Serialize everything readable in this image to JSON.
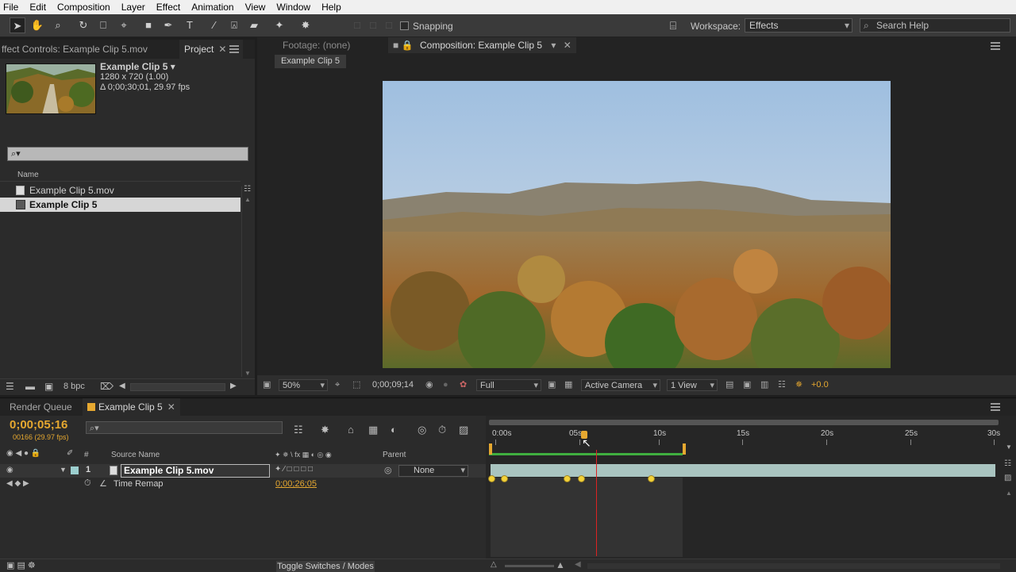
{
  "menu": [
    "File",
    "Edit",
    "Composition",
    "Layer",
    "Effect",
    "Animation",
    "View",
    "Window",
    "Help"
  ],
  "toolbar": {
    "snapping_label": "Snapping",
    "workspace_label": "Workspace:",
    "workspace_value": "Effects",
    "search_placeholder": "Search Help"
  },
  "left_panel": {
    "tabs": [
      "ffect Controls: Example Clip 5.mov",
      "Project"
    ],
    "project": {
      "name": "Example Clip 5 ▾",
      "info_line1": "1280 x 720 (1.00)",
      "info_line2": "Δ 0;00;30;01, 29.97 fps",
      "search_icon": "⌕▾",
      "column_name": "Name",
      "items": [
        "Example Clip 5.mov",
        "Example Clip 5"
      ],
      "bpc": "8 bpc"
    }
  },
  "comp_panel": {
    "footage_tab": "Footage: (none)",
    "comp_tab": "Composition: Example Clip 5",
    "breadcrumb": "Example Clip 5",
    "zoom": "50%",
    "timecode": "0;00;09;14",
    "resolution": "Full",
    "camera": "Active Camera",
    "views": "1 View",
    "exposure": "+0.0"
  },
  "timeline": {
    "tabs": [
      "Render Queue",
      "Example Clip 5"
    ],
    "timecode": "0;00;05;16",
    "frames": "00166 (29.97 fps)",
    "col_source_name": "Source Name",
    "col_parent": "Parent",
    "col_num": "#",
    "layer_num": "1",
    "layer_name": "Example Clip 5.mov",
    "parent_value": "None",
    "time_remap_label": "Time Remap",
    "time_remap_value": "0;00;26;05",
    "ruler_labels": [
      "0:00s",
      "05s",
      "10s",
      "15s",
      "20s",
      "25s",
      "30s"
    ],
    "toggle_label": "Toggle Switches / Modes"
  },
  "colors": {
    "accent": "#e6a830",
    "playhead": "#dd2222",
    "keyframe": "#f3d23a",
    "layer_bar": "#a9c4c0"
  }
}
